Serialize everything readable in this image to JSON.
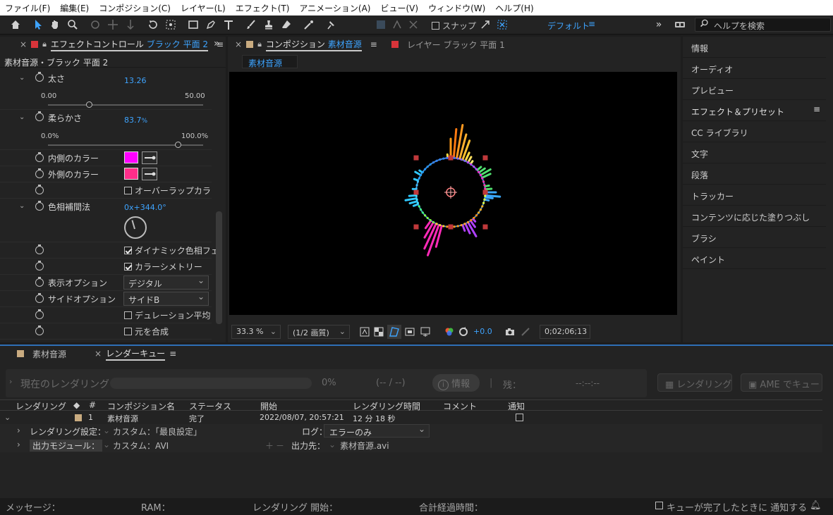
{
  "menu": [
    "ファイル(F)",
    "編集(E)",
    "コンポジション(C)",
    "レイヤー(L)",
    "エフェクト(T)",
    "アニメーション(A)",
    "ビュー(V)",
    "ウィンドウ(W)",
    "ヘルプ(H)"
  ],
  "toolbar": {
    "snap_label": "スナップ",
    "snap_checked": false,
    "workspace": "デフォルト",
    "help_search_placeholder": "ヘルプを検索"
  },
  "left_panel": {
    "tab_label": "エフェクトコントロール",
    "tab_target": "ブラック 平面 2",
    "subtitle": "素材音源・ブラック 平面 2",
    "props": {
      "thickness": {
        "label": "太さ",
        "value": "13.26",
        "min": "0.00",
        "max": "50.00",
        "level": 0.265
      },
      "softness": {
        "label": "柔らかさ",
        "value": "83.7",
        "unit": "%",
        "min": "0.0%",
        "max": "100.0%",
        "level": 0.837
      },
      "inner_color": {
        "label": "内側のカラー",
        "color": "#ff00ff"
      },
      "outer_color": {
        "label": "外側のカラー",
        "color": "#ff2d8a"
      },
      "overlap_color": {
        "label": "オーバーラップカラ",
        "checked": false
      },
      "hue_interp": {
        "label": "色相補間法",
        "value": "0x+344.0°"
      },
      "dynamic_hue": {
        "label": "ダイナミック色相フェ",
        "checked": true
      },
      "color_symmetry": {
        "label": "カラーシメトリー",
        "checked": true
      },
      "display_opt": {
        "label": "表示オプション",
        "value": "デジタル"
      },
      "side_opt": {
        "label": "サイドオプション",
        "value": "サイドB"
      },
      "duration_avg": {
        "label": "デュレーション平均",
        "checked": false
      },
      "composite": {
        "label": "元を合成",
        "checked": false
      }
    }
  },
  "comp_panel": {
    "tab_label": "コンポジション",
    "tab_target": "素材音源",
    "layer_tab": "レイヤー ブラック 平面 1",
    "comp_name": "素材音源",
    "zoom": "33.3 %",
    "resolution": "(1/2 画質)",
    "exposure": "+0.0",
    "timecode": "0;02;06;13"
  },
  "right_panel": {
    "items": [
      "情報",
      "オーディオ",
      "プレビュー",
      "エフェクト＆プリセット",
      "CC ライブラリ",
      "文字",
      "段落",
      "トラッカー",
      "コンテンツに応じた塗りつぶし",
      "ブラシ",
      "ペイント"
    ]
  },
  "render_queue": {
    "tab_source": "素材音源",
    "tab_label": "レンダーキュー",
    "current_label": "現在のレンダリング",
    "percent": "0%",
    "progress": 0,
    "frames": "(-- / --)",
    "info_btn": "情報",
    "remain_label": "残：",
    "remain_value": "--:--:--",
    "render_btn": "レンダリング",
    "ame_btn": "AME でキュー",
    "headers": [
      "レンダリング",
      "#",
      "コンポジション名",
      "ステータス",
      "開始",
      "レンダリング時間",
      "コメント",
      "通知"
    ],
    "row": {
      "num": "1",
      "comp": "素材音源",
      "status": "完了",
      "start": "2022/08/07, 20:57:21",
      "time": "12 分 18 秒"
    },
    "render_settings_label": "レンダリング設定：",
    "render_settings_value": "カスタム：「最良設定」",
    "log_label": "ログ：",
    "log_value": "エラーのみ",
    "output_module_label": "出力モジュール：",
    "output_module_value": "カスタム：AVI",
    "output_to_label": "出力先：",
    "output_to_value": "素材音源.avi"
  },
  "status_bar": {
    "message": "メッセージ：",
    "ram": "RAM：",
    "render_start": "レンダリング 開始：",
    "elapsed": "合計経過時間：",
    "notify": "キューが完了したときに 通知する"
  }
}
